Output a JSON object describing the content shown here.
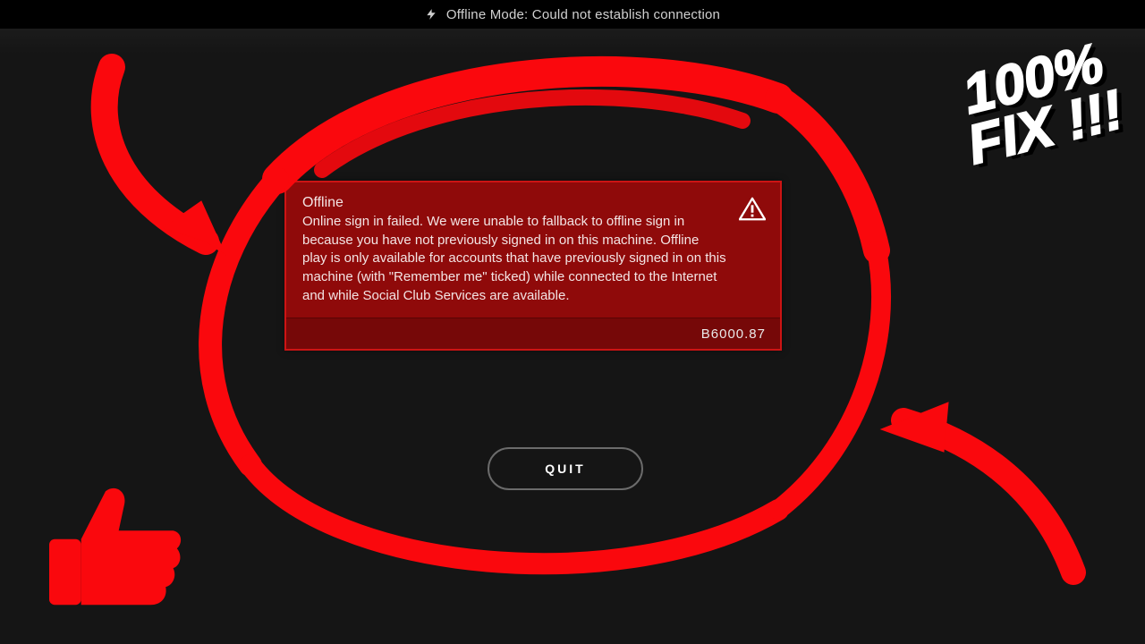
{
  "status_bar": {
    "text": "Offline Mode: Could not establish connection"
  },
  "error": {
    "title": "Offline",
    "body": "Online sign in failed. We were unable to fallback to offline sign in because you have not previously signed in on this machine. Offline play is only available for accounts that have previously signed in on this machine (with \"Remember me\" ticked) while connected to the Internet and while Social Club Services are available.",
    "code": "B6000.87"
  },
  "buttons": {
    "quit": "QUIT"
  },
  "overlay": {
    "text_line1": "100%",
    "text_line2": "FIX !!!"
  },
  "colors": {
    "accent_red": "#fa080d",
    "card_red": "#8f0a0a",
    "card_border": "#cc1414"
  }
}
